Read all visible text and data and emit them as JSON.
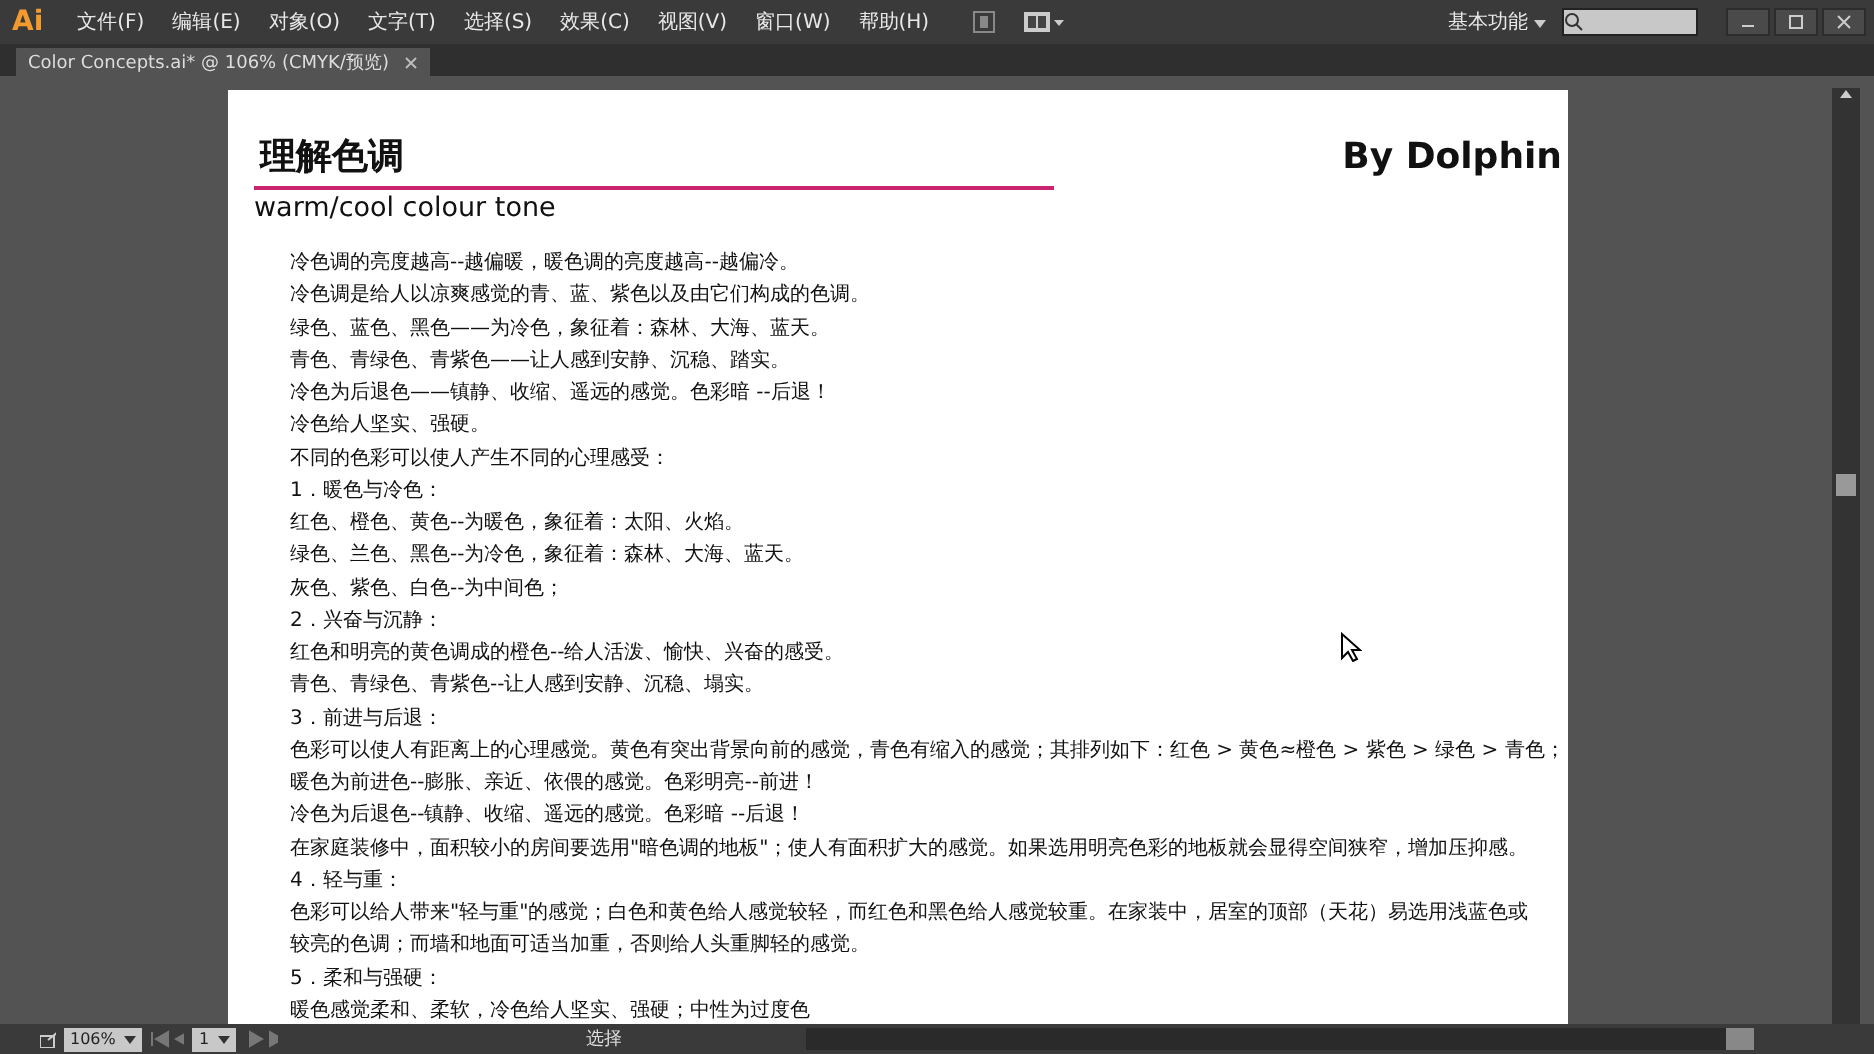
{
  "app": {
    "logo": "Ai",
    "menus": [
      "文件(F)",
      "编辑(E)",
      "对象(O)",
      "文字(T)",
      "选择(S)",
      "效果(C)",
      "视图(V)",
      "窗口(W)",
      "帮助(H)"
    ],
    "workspace": "基本功能"
  },
  "tabs": [
    {
      "label": "Color Concepts.ai* @ 106% (CMYK/预览)",
      "selected": true
    }
  ],
  "artboard": {
    "heading": "理解色调",
    "author": "By Dolphin",
    "subtitle": "warm/cool colour tone",
    "lines": [
      "冷色调的亮度越高--越偏暖，暖色调的亮度越高--越偏冷。",
      "冷色调是给人以凉爽感觉的青、蓝、紫色以及由它们构成的色调。",
      "绿色、蓝色、黑色——为冷色，象征着：森林、大海、蓝天。",
      "青色、青绿色、青紫色——让人感到安静、沉稳、踏实。",
      "冷色为后退色——镇静、收缩、遥远的感觉。色彩暗 --后退！",
      "冷色给人坚实、强硬。",
      "不同的色彩可以使人产生不同的心理感受：",
      "1．暖色与冷色：",
      "红色、橙色、黄色--为暖色，象征着：太阳、火焰。",
      "绿色、兰色、黑色--为冷色，象征着：森林、大海、蓝天。",
      "灰色、紫色、白色--为中间色；",
      "2．兴奋与沉静：",
      "红色和明亮的黄色调成的橙色--给人活泼、愉快、兴奋的感受。",
      "青色、青绿色、青紫色--让人感到安静、沉稳、塌实。",
      "3．前进与后退：",
      "色彩可以使人有距离上的心理感觉。黄色有突出背景向前的感觉，青色有缩入的感觉；其排列如下：红色 > 黄色≈橙色 > 紫色 > 绿色 > 青色；",
      "暖色为前进色--膨胀、亲近、依偎的感觉。色彩明亮--前进！",
      "冷色为后退色--镇静、收缩、遥远的感觉。色彩暗 --后退！",
      "在家庭装修中，面积较小的房间要选用\"暗色调的地板\"；使人有面积扩大的感觉。如果选用明亮色彩的地板就会显得空间狭窄，增加压抑感。",
      "4．轻与重：",
      "色彩可以给人带来\"轻与重\"的感觉；白色和黄色给人感觉较轻，而红色和黑色给人感觉较重。在家装中，居室的顶部（天花）易选用浅蓝色或",
      "较亮的色调；而墙和地面可适当加重，否则给人头重脚轻的感觉。",
      "5．柔和与强硬：",
      "暖色感觉柔和、柔软，冷色给人坚实、强硬；中性为过度色"
    ]
  },
  "status_bar": {
    "zoom": "106%",
    "page": "1",
    "tool": "选择"
  }
}
